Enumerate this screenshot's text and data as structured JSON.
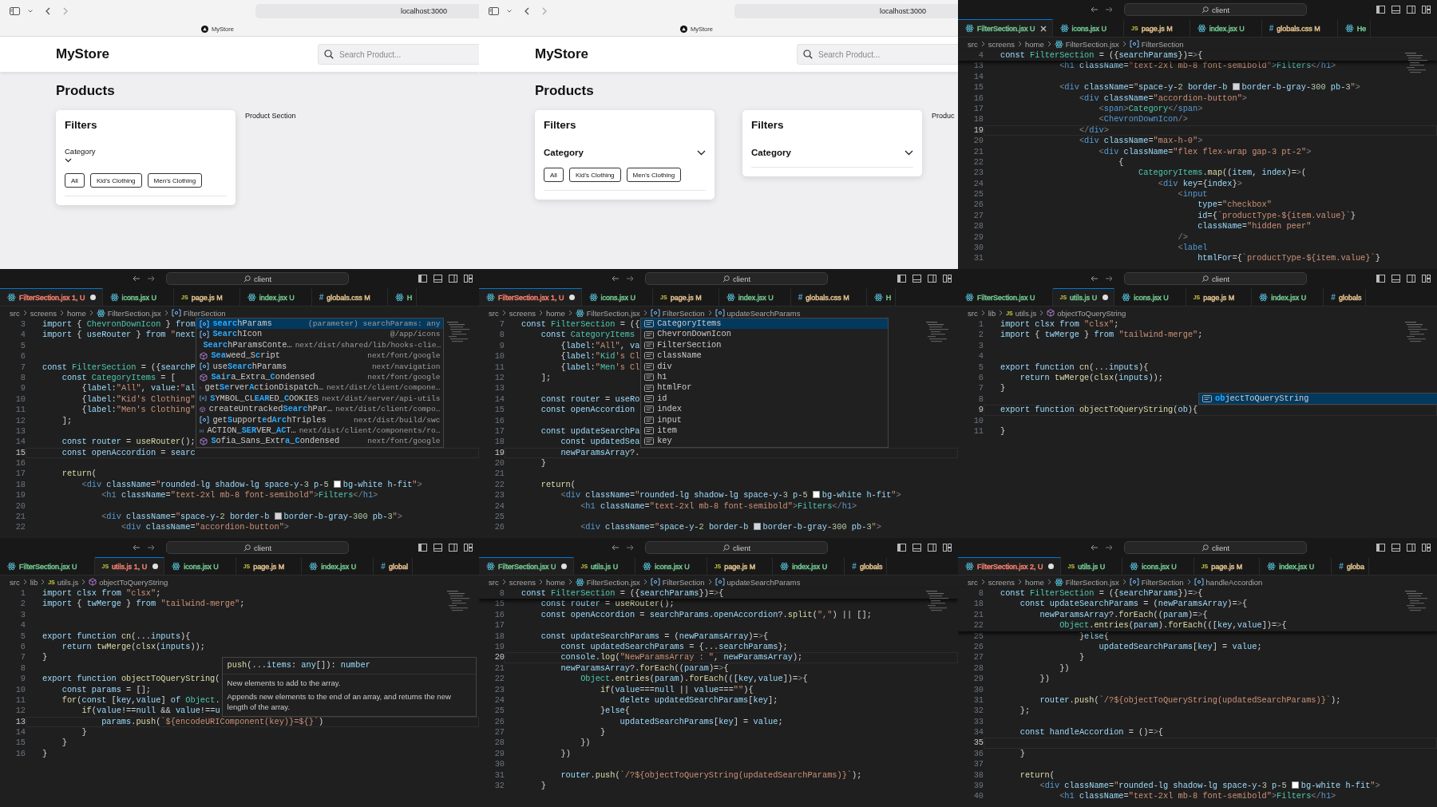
{
  "panels": [
    {
      "kind": "browser",
      "url": "localhost:3000",
      "tab_title": "MyStore",
      "site_title": "MyStore",
      "search_placeholder": "Search Product...",
      "heading": "Products",
      "cards": [
        {
          "kind": "plain",
          "title": "Filters",
          "category": "Category",
          "chips": [
            "All",
            "Kid's Clothing",
            "Men's Clothing"
          ]
        }
      ],
      "side_text": "Product Section"
    },
    {
      "kind": "browser",
      "url": "localhost:3000",
      "tab_title": "MyStore",
      "site_title": "MyStore",
      "search_placeholder": "Search Product...",
      "heading": "Products",
      "cards": [
        {
          "kind": "accordion",
          "title": "Filters",
          "category": "Category",
          "chips": [
            "All",
            "Kid's Clothing",
            "Men's Clothing"
          ]
        },
        {
          "kind": "accordion",
          "title": "Filters",
          "category": "Category"
        }
      ],
      "side_text": "Produc"
    },
    {
      "kind": "editor",
      "search": "client",
      "tabs": [
        {
          "kind": "react",
          "label": "FilterSection.jsx",
          "badge": "U",
          "color": "#73c991",
          "selected": true,
          "dirty": false
        },
        {
          "kind": "react",
          "label": "icons.jsx",
          "badge": "U",
          "color": "#73c991",
          "selected": false,
          "dirty": false
        },
        {
          "kind": "js",
          "glyph": "JS",
          "label": "page.js",
          "badge": "M",
          "color": "#e2c08d",
          "selected": false,
          "dirty": false
        },
        {
          "kind": "react",
          "label": "index.jsx",
          "badge": "U",
          "color": "#73c991",
          "selected": false,
          "dirty": false
        },
        {
          "kind": "css",
          "glyph": "#",
          "label": "globals.css",
          "badge": "M",
          "color": "#e2c08d",
          "selected": false,
          "dirty": false
        },
        {
          "kind": "react",
          "label": "He",
          "color": "#73c991",
          "selected": false
        }
      ],
      "breadcrumb": [
        {
          "label": "src"
        },
        {
          "label": "screens"
        },
        {
          "label": "home"
        },
        {
          "label": "FilterSection.jsx",
          "kind": "react"
        },
        {
          "label": "FilterSection",
          "kind": "variable"
        }
      ],
      "sticky": [
        {
          "num": "4",
          "code": "const FilterSection = ({searchParams})=>{"
        }
      ],
      "lines": [
        {
          "num": "13",
          "code": "            <h1 className=\"text-2xl mb-8 font-semibold\">Filters</h1>",
          "current": false
        },
        {
          "num": "14",
          "current": false
        },
        {
          "num": "15",
          "code": [
            "            <div className=\"space-y-2 border-b ",
            "border-b-gray-300 pb-3\">"
          ],
          "swatch": {
            "color": "#d1d5db"
          },
          "current": false
        },
        {
          "num": "16",
          "code": "                <div className=\"accordion-button\">",
          "current": false
        },
        {
          "num": "17",
          "code": "                    <span>Category</span>",
          "current": false
        },
        {
          "num": "18",
          "code": "                    <ChevronDownIcon/>",
          "current": false
        },
        {
          "num": "19",
          "code": "                </div>",
          "current": true
        },
        {
          "num": "20",
          "code": "                <div className=\"max-h-0\">",
          "current": false
        },
        {
          "num": "21",
          "code": "                    <div className=\"flex flex-wrap gap-3 pt-2\">",
          "current": false
        },
        {
          "num": "22",
          "code": "                        {",
          "current": false
        },
        {
          "num": "23",
          "code": "                            CategoryItems.map((item, index)=>(",
          "current": false
        },
        {
          "num": "24",
          "code": "                                <div key={index}>",
          "current": false
        },
        {
          "num": "25",
          "code": "                                    <input",
          "current": false
        },
        {
          "num": "26",
          "code": "                                        type=\"checkbox\"",
          "current": false
        },
        {
          "num": "27",
          "code": "                                        id={`productType-${item.value}`}",
          "current": false
        },
        {
          "num": "28",
          "code": "                                        className=\"hidden peer\"",
          "current": false
        },
        {
          "num": "29",
          "code": "                                    />",
          "current": false
        },
        {
          "num": "30",
          "code": "                                    <label",
          "current": false
        },
        {
          "num": "31",
          "code": "                                        htmlFor={`productType-${item.value}`}",
          "current": false
        }
      ]
    },
    {
      "kind": "editor",
      "search": "client",
      "tabs": [
        {
          "kind": "react",
          "label": "FilterSection.jsx",
          "badge": "1, U",
          "color": "#f88070",
          "selected": true,
          "dirty": true
        },
        {
          "kind": "react",
          "label": "icons.jsx",
          "badge": "U",
          "color": "#73c991",
          "selected": false,
          "dirty": false
        },
        {
          "kind": "js",
          "glyph": "JS",
          "label": "page.js",
          "badge": "M",
          "color": "#e2c08d",
          "selected": false,
          "dirty": false
        },
        {
          "kind": "react",
          "label": "index.jsx",
          "badge": "U",
          "color": "#73c991",
          "selected": false,
          "dirty": false
        },
        {
          "kind": "css",
          "glyph": "#",
          "label": "globals.css",
          "badge": "M",
          "color": "#e2c08d",
          "selected": false,
          "dirty": false
        },
        {
          "kind": "react",
          "label": "H",
          "color": "#73c991",
          "selected": false
        }
      ],
      "breadcrumb": [
        {
          "label": "src"
        },
        {
          "label": "screens"
        },
        {
          "label": "home"
        },
        {
          "label": "FilterSection.jsx",
          "kind": "react"
        },
        {
          "label": "FilterSection",
          "kind": "variable"
        }
      ],
      "lines": [
        {
          "num": "3",
          "code": "import { ChevronDownIcon } from",
          "current": false
        },
        {
          "num": "4",
          "code": "import { useRouter } from \"next",
          "current": false
        },
        {
          "num": "5",
          "current": false
        },
        {
          "num": "6",
          "current": false
        },
        {
          "num": "7",
          "code": "const FilterSection = ({searchP",
          "current": false
        },
        {
          "num": "8",
          "code": "    const CategoryItems = [",
          "current": false
        },
        {
          "num": "9",
          "code": "        {label:\"All\", value:\"al",
          "current": false
        },
        {
          "num": "10",
          "code": "        {label:\"Kid's Clothing\"",
          "current": false
        },
        {
          "num": "11",
          "code": "        {label:\"Men's Clothing\"",
          "current": false
        },
        {
          "num": "12",
          "code": "    ];",
          "current": false
        },
        {
          "num": "13",
          "current": false
        },
        {
          "num": "14",
          "code": "    const router = useRouter();",
          "current": false
        },
        {
          "num": "15",
          "code": "    const openAccordion = searc",
          "current": true,
          "suggest": {
            "items": [
              {
                "kind": "variable",
                "label": "**searc**hParams",
                "detail": "(parameter) searchParams: any",
                "selected": true
              },
              {
                "kind": "variable",
                "label": "**Searc**hIcon",
                "detail": "@/app/icons",
                "selected": false
              },
              {
                "kind": "variable",
                "label": "**Searc**hParamsConte…",
                "detail": "next/dist/shared/lib/hooks-clie…",
                "selected": false
              },
              {
                "kind": "function",
                "label": "**Sea**weed_S**c**ript",
                "detail": "next/font/google",
                "selected": false
              },
              {
                "kind": "variable",
                "label": "use**Searc**hParams",
                "detail": "next/navigation",
                "selected": false
              },
              {
                "kind": "function",
                "label": "**Sa**i**r**a_Extra_**C**ondensed",
                "detail": "next/font/google",
                "selected": false
              },
              {
                "kind": "function",
                "label": "get**Se**rver**A**ctionDispatch…",
                "detail": "next/dist/client/compone…",
                "selected": false
              },
              {
                "kind": "variable",
                "label": "**S**YMBOL_CL**EAR**ED_**C**OOKIES",
                "detail": "next/dist/server/api-utils",
                "selected": false
              },
              {
                "kind": "function",
                "label": "createUntracked**Searc**hPar…",
                "detail": "next/dist/client/compo…",
                "selected": false
              },
              {
                "kind": "variable",
                "label": "get**S**upport**e**d**Arc**hTriples",
                "detail": "next/dist/build/swc",
                "selected": false
              },
              {
                "kind": "variable",
                "label": "ACTION_**SER**VER_**AC**T…",
                "detail": "next/dist/client/components/ro…",
                "selected": false
              },
              {
                "kind": "function",
                "label": "**S**ofia_Sans_Extr**a**_**C**ondensed",
                "detail": "next/font/google",
                "selected": false
              }
            ]
          }
        },
        {
          "num": "16",
          "current": false
        },
        {
          "num": "17",
          "code": "    return(",
          "current": false
        },
        {
          "num": "18",
          "code": [
            "        <div className=\"rounded-lg shadow-lg space-y-3 p-5 ",
            "bg-white h-fit\">"
          ],
          "swatch": {
            "color": "#ffffff"
          },
          "current": false
        },
        {
          "num": "19",
          "code": "            <h1 className=\"text-2xl mb-8 font-semibold\">Filters</h1>",
          "current": false
        },
        {
          "num": "20",
          "current": false
        },
        {
          "num": "21",
          "code": [
            "            <div className=\"space-y-2 border-b ",
            "border-b-gray-300 pb-3\">"
          ],
          "swatch": {
            "color": "#d1d5db"
          },
          "current": false
        },
        {
          "num": "22",
          "code": "                <div className=\"accordion-button\">",
          "current": false
        }
      ]
    },
    {
      "kind": "editor",
      "search": "client",
      "tabs": [
        {
          "kind": "react",
          "label": "FilterSection.jsx",
          "badge": "1, U",
          "color": "#f88070",
          "selected": true,
          "dirty": true
        },
        {
          "kind": "react",
          "label": "icons.jsx",
          "badge": "U",
          "color": "#73c991",
          "selected": false,
          "dirty": false
        },
        {
          "kind": "js",
          "glyph": "JS",
          "label": "page.js",
          "badge": "M",
          "color": "#e2c08d",
          "selected": false,
          "dirty": false
        },
        {
          "kind": "react",
          "label": "index.jsx",
          "badge": "U",
          "color": "#73c991",
          "selected": false,
          "dirty": false
        },
        {
          "kind": "css",
          "glyph": "#",
          "label": "globals.css",
          "badge": "M",
          "color": "#e2c08d",
          "selected": false,
          "dirty": false
        },
        {
          "kind": "react",
          "label": "H",
          "color": "#73c991",
          "selected": false
        }
      ],
      "breadcrumb": [
        {
          "label": "src"
        },
        {
          "label": "screens"
        },
        {
          "label": "home"
        },
        {
          "label": "FilterSection.jsx",
          "kind": "react"
        },
        {
          "label": "FilterSection",
          "kind": "variable"
        },
        {
          "label": "updateSearchParams",
          "kind": "variable"
        }
      ],
      "lines": [
        {
          "num": "7",
          "code": "const FilterSection = ({",
          "current": false
        },
        {
          "num": "8",
          "code": "    const CategoryItems",
          "current": false
        },
        {
          "num": "9",
          "code": "        {label:\"All\", va",
          "current": false
        },
        {
          "num": "10",
          "code": "        {label:\"Kid's Cl",
          "current": false
        },
        {
          "num": "11",
          "code": "        {label:\"Men's Cl",
          "current": false
        },
        {
          "num": "12",
          "code": "    ];",
          "current": false
        },
        {
          "num": "13",
          "current": false
        },
        {
          "num": "14",
          "code": "    const router = useRo",
          "current": false
        },
        {
          "num": "15",
          "code": "    const openAccordion",
          "current": false
        },
        {
          "num": "16",
          "current": false
        },
        {
          "num": "17",
          "code": "    const updateSearchPa",
          "current": false
        },
        {
          "num": "18",
          "code": "        const updatedSea",
          "current": false
        },
        {
          "num": "19",
          "code": "        newParamsArray?.",
          "current": true,
          "suggest": {
            "items": [
              {
                "kind": "word",
                "label": "CategoryItems",
                "selected": true
              },
              {
                "kind": "word",
                "label": "ChevronDownIcon",
                "selected": false
              },
              {
                "kind": "word",
                "label": "FilterSection",
                "selected": false
              },
              {
                "kind": "word",
                "label": "className",
                "selected": false
              },
              {
                "kind": "word",
                "label": "div",
                "selected": false
              },
              {
                "kind": "word",
                "label": "h1",
                "selected": false
              },
              {
                "kind": "word",
                "label": "htmlFor",
                "selected": false
              },
              {
                "kind": "word",
                "label": "id",
                "selected": false
              },
              {
                "kind": "word",
                "label": "index",
                "selected": false
              },
              {
                "kind": "word",
                "label": "input",
                "selected": false
              },
              {
                "kind": "word",
                "label": "item",
                "selected": false
              },
              {
                "kind": "word",
                "label": "key",
                "selected": false
              }
            ]
          }
        },
        {
          "num": "20",
          "code": "    }",
          "current": false
        },
        {
          "num": "21",
          "current": false
        },
        {
          "num": "22",
          "code": "    return(",
          "current": false
        },
        {
          "num": "23",
          "code": [
            "        <div className=\"rounded-lg shadow-lg space-y-3 p-5 ",
            "bg-white h-fit\">"
          ],
          "swatch": {
            "color": "#ffffff"
          },
          "current": false
        },
        {
          "num": "24",
          "code": "            <h1 className=\"text-2xl mb-8 font-semibold\">Filters</h1>",
          "current": false
        },
        {
          "num": "25",
          "current": false
        },
        {
          "num": "26",
          "code": [
            "            <div className=\"space-y-2 border-b ",
            "border-b-gray-300 pb-3\">"
          ],
          "swatch": {
            "color": "#d1d5db"
          },
          "current": false
        }
      ]
    },
    {
      "kind": "editor",
      "search": "client",
      "tabs": [
        {
          "kind": "react",
          "label": "FilterSection.jsx",
          "badge": "U",
          "color": "#73c991",
          "selected": false,
          "dirty": false
        },
        {
          "kind": "js",
          "glyph": "JS",
          "label": "utils.js",
          "badge": "U",
          "color": "#73c991",
          "selected": true,
          "dirty": true
        },
        {
          "kind": "react",
          "label": "icons.jsx",
          "badge": "U",
          "color": "#73c991",
          "selected": false,
          "dirty": false
        },
        {
          "kind": "js",
          "glyph": "JS",
          "label": "page.js",
          "badge": "M",
          "color": "#e2c08d",
          "selected": false,
          "dirty": false
        },
        {
          "kind": "react",
          "label": "index.jsx",
          "badge": "U",
          "color": "#73c991",
          "selected": false,
          "dirty": false
        },
        {
          "kind": "css",
          "glyph": "#",
          "label": "globals",
          "color": "#e2c08d",
          "selected": false
        }
      ],
      "breadcrumb": [
        {
          "label": "src"
        },
        {
          "label": "lib"
        },
        {
          "label": "utils.js",
          "kind": "js",
          "glyph": "JS"
        },
        {
          "label": "objectToQueryString",
          "kind": "function"
        }
      ],
      "lines": [
        {
          "num": "1",
          "code": "import clsx from \"clsx\";",
          "current": false
        },
        {
          "num": "2",
          "code": "import { twMerge } from \"tailwind-merge\";",
          "current": false
        },
        {
          "num": "3",
          "current": false
        },
        {
          "num": "4",
          "current": false
        },
        {
          "num": "5",
          "code": "export function cn(...inputs){",
          "current": false
        },
        {
          "num": "6",
          "code": "    return twMerge(clsx(inputs));",
          "current": false
        },
        {
          "num": "7",
          "code": "}",
          "current": false
        },
        {
          "num": "8",
          "current": false
        },
        {
          "num": "9",
          "code": "export function objectToQueryString(ob){",
          "current": true,
          "suggest": {
            "items": [
              {
                "kind": "word",
                "label": "**ob**jectToQueryString",
                "selected": true
              }
            ]
          }
        },
        {
          "num": "10",
          "current": false
        },
        {
          "num": "11",
          "code": "}",
          "current": false
        }
      ]
    },
    {
      "kind": "editor",
      "search": "client",
      "tabs": [
        {
          "kind": "react",
          "label": "FilterSection.jsx",
          "badge": "U",
          "color": "#73c991",
          "selected": false,
          "dirty": false
        },
        {
          "kind": "js",
          "glyph": "JS",
          "label": "utils.js",
          "badge": "1, U",
          "color": "#f88070",
          "selected": true,
          "dirty": true
        },
        {
          "kind": "react",
          "label": "icons.jsx",
          "badge": "U",
          "color": "#73c991",
          "selected": false,
          "dirty": false
        },
        {
          "kind": "js",
          "glyph": "JS",
          "label": "page.js",
          "badge": "M",
          "color": "#e2c08d",
          "selected": false,
          "dirty": false
        },
        {
          "kind": "react",
          "label": "index.jsx",
          "badge": "U",
          "color": "#73c991",
          "selected": false,
          "dirty": false
        },
        {
          "kind": "css",
          "glyph": "#",
          "label": "global",
          "color": "#e2c08d",
          "selected": false
        }
      ],
      "breadcrumb": [
        {
          "label": "src"
        },
        {
          "label": "lib"
        },
        {
          "label": "utils.js",
          "kind": "js",
          "glyph": "JS"
        },
        {
          "label": "objectToQueryString",
          "kind": "function"
        }
      ],
      "lines": [
        {
          "num": "1",
          "code": "import clsx from \"clsx\";",
          "current": false
        },
        {
          "num": "2",
          "code": "import { twMerge } from \"tailwind-merge\";",
          "current": false
        },
        {
          "num": "3",
          "current": false
        },
        {
          "num": "4",
          "current": false
        },
        {
          "num": "5",
          "code": "export function cn(...inputs){",
          "current": false
        },
        {
          "num": "6",
          "code": "    return twMerge(clsx(inputs));",
          "current": false
        },
        {
          "num": "7",
          "code": "}",
          "current": false
        },
        {
          "num": "8",
          "current": false
        },
        {
          "num": "9",
          "code": "export function objectToQueryString(",
          "current": false
        },
        {
          "num": "10",
          "code": "    const params = [];",
          "current": false
        },
        {
          "num": "11",
          "code": "    for(const [key,value] of Object.",
          "current": false
        },
        {
          "num": "12",
          "code": "        if(value!==null && value!==u",
          "current": false
        },
        {
          "num": "13",
          "code": "            params.push(`${encodeURIComponent(key)}=${}`)",
          "current": true,
          "hover": {
            "signature": "push(...items: any[]): number",
            "docs": [
              "New elements to add to the array.",
              "Appends new elements to the end of an array, and returns the new length of the array."
            ]
          }
        },
        {
          "num": "14",
          "code": "        }",
          "current": false
        },
        {
          "num": "15",
          "code": "    }",
          "current": false
        },
        {
          "num": "16",
          "code": "}",
          "current": false
        }
      ]
    },
    {
      "kind": "editor",
      "search": "client",
      "tabs": [
        {
          "kind": "react",
          "label": "FilterSection.jsx",
          "badge": "U",
          "color": "#73c991",
          "selected": true,
          "dirty": true
        },
        {
          "kind": "js",
          "glyph": "JS",
          "label": "utils.js",
          "badge": "U",
          "color": "#73c991",
          "selected": false,
          "dirty": false
        },
        {
          "kind": "react",
          "label": "icons.jsx",
          "badge": "U",
          "color": "#73c991",
          "selected": false,
          "dirty": false
        },
        {
          "kind": "js",
          "glyph": "JS",
          "label": "page.js",
          "badge": "M",
          "color": "#e2c08d",
          "selected": false,
          "dirty": false
        },
        {
          "kind": "react",
          "label": "index.jsx",
          "badge": "U",
          "color": "#73c991",
          "selected": false,
          "dirty": false
        },
        {
          "kind": "css",
          "glyph": "#",
          "label": "globals",
          "color": "#e2c08d",
          "selected": false
        }
      ],
      "breadcrumb": [
        {
          "label": "src"
        },
        {
          "label": "screens"
        },
        {
          "label": "home"
        },
        {
          "label": "FilterSection.jsx",
          "kind": "react"
        },
        {
          "label": "FilterSection",
          "kind": "variable"
        },
        {
          "label": "updateSearchParams",
          "kind": "variable"
        }
      ],
      "sticky": [
        {
          "num": "8",
          "code": "const FilterSection = ({searchParams})=>{"
        }
      ],
      "lines": [
        {
          "num": "15",
          "code": "    const router = useRouter();",
          "current": false
        },
        {
          "num": "16",
          "code": "    const openAccordion = searchParams.openAccordion?.split(\",\") || [];",
          "current": false
        },
        {
          "num": "17",
          "current": false
        },
        {
          "num": "18",
          "code": "    const updateSearchParams = (newParamsArray)=>{",
          "current": false
        },
        {
          "num": "19",
          "code": "        const updatedSearchParams = {...searchParams};",
          "current": false
        },
        {
          "num": "20",
          "code": "        console.log(\"NewParamsArray : \", newParamsArray);",
          "current": true
        },
        {
          "num": "21",
          "code": "        newParamsArray?.forEach((param)=>{",
          "current": false
        },
        {
          "num": "22",
          "code": "            Object.entries(param).forEach(([key,value])=>{",
          "current": false
        },
        {
          "num": "23",
          "code": "                if(value===null || value===\"\"){",
          "current": false
        },
        {
          "num": "24",
          "code": "                    delete updatedSearchParams[key];",
          "current": false
        },
        {
          "num": "25",
          "code": "                }else{",
          "current": false
        },
        {
          "num": "26",
          "code": "                    updatedSearchParams[key] = value;",
          "current": false
        },
        {
          "num": "27",
          "code": "                }",
          "current": false
        },
        {
          "num": "28",
          "code": "            })",
          "current": false
        },
        {
          "num": "29",
          "code": "        })",
          "current": false
        },
        {
          "num": "30",
          "current": false
        },
        {
          "num": "31",
          "code": "        router.push(`/?${objectToQueryString(updatedSearchParams)}`);",
          "current": false
        },
        {
          "num": "32",
          "code": "    }",
          "current": false
        }
      ]
    },
    {
      "kind": "editor",
      "search": "client",
      "tabs": [
        {
          "kind": "react",
          "label": "FilterSection.jsx",
          "badge": "2, U",
          "color": "#f88070",
          "selected": true,
          "dirty": true
        },
        {
          "kind": "js",
          "glyph": "JS",
          "label": "utils.js",
          "badge": "U",
          "color": "#73c991",
          "selected": false,
          "dirty": false
        },
        {
          "kind": "react",
          "label": "icons.jsx",
          "badge": "U",
          "color": "#73c991",
          "selected": false,
          "dirty": false
        },
        {
          "kind": "js",
          "glyph": "JS",
          "label": "page.js",
          "badge": "M",
          "color": "#e2c08d",
          "selected": false,
          "dirty": false
        },
        {
          "kind": "react",
          "label": "index.jsx",
          "badge": "U",
          "color": "#73c991",
          "selected": false,
          "dirty": false
        },
        {
          "kind": "css",
          "glyph": "#",
          "label": "globa",
          "color": "#e2c08d",
          "selected": false
        }
      ],
      "breadcrumb": [
        {
          "label": "src"
        },
        {
          "label": "screens"
        },
        {
          "label": "home"
        },
        {
          "label": "FilterSection.jsx",
          "kind": "react"
        },
        {
          "label": "FilterSection",
          "kind": "variable"
        },
        {
          "label": "handleAccordion",
          "kind": "variable"
        }
      ],
      "sticky": [
        {
          "num": "8",
          "code": "const FilterSection = ({searchParams})=>{"
        },
        {
          "num": "18",
          "code": "    const updateSearchParams = (newParamsArray)=>{"
        },
        {
          "num": "21",
          "code": "        newParamsArray?.forEach((param)=>{"
        },
        {
          "num": "22",
          "code": "            Object.entries(param).forEach(([key,value])=>{"
        }
      ],
      "lines": [
        {
          "num": "25",
          "code": "                }else{",
          "current": false
        },
        {
          "num": "26",
          "code": "                    updatedSearchParams[key] = value;",
          "current": false
        },
        {
          "num": "27",
          "code": "                }",
          "current": false
        },
        {
          "num": "28",
          "code": "            })",
          "current": false
        },
        {
          "num": "29",
          "code": "        })",
          "current": false
        },
        {
          "num": "30",
          "current": false
        },
        {
          "num": "31",
          "code": "        router.push(`/?${objectToQueryString(updatedSearchParams)}`);",
          "current": false
        },
        {
          "num": "32",
          "code": "    };",
          "current": false
        },
        {
          "num": "33",
          "current": false
        },
        {
          "num": "34",
          "code": "    const handleAccordion = ()=>{",
          "current": false
        },
        {
          "num": "35",
          "current": true
        },
        {
          "num": "36",
          "code": "    }",
          "current": false
        },
        {
          "num": "37",
          "current": false
        },
        {
          "num": "38",
          "code": "    return(",
          "current": false
        },
        {
          "num": "39",
          "code": [
            "        <div className=\"rounded-lg shadow-lg space-y-3 p-5 ",
            "bg-white h-fit\">"
          ],
          "swatch": {
            "color": "#ffffff"
          },
          "current": false
        },
        {
          "num": "40",
          "code": "            <h1 className=\"text-2xl mb-8 font-semibold\">Filters</h1>",
          "current": false
        }
      ]
    }
  ]
}
